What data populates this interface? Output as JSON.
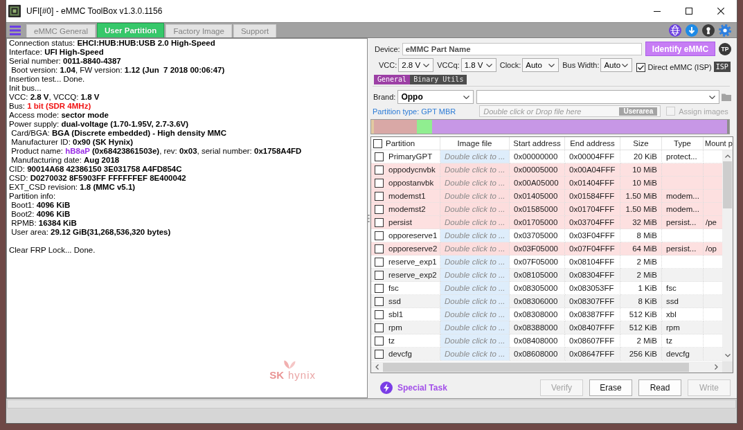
{
  "window": {
    "title": "UFI[#0] - eMMC ToolBox v1.3.0.1156"
  },
  "tabs": [
    {
      "label": "eMMC General",
      "selected": false
    },
    {
      "label": "User Partition",
      "selected": true
    },
    {
      "label": "Factory Image",
      "selected": false
    },
    {
      "label": "Support",
      "selected": false
    }
  ],
  "log": {
    "paragraphs": [
      {
        "lines": [
          {
            "parts": [
              {
                "kind": "label",
                "text": "Connection status: "
              },
              {
                "kind": "value",
                "text": "EHCI:HUB:HUB:USB 2.0 High-Speed"
              }
            ]
          },
          {
            "parts": [
              {
                "kind": "label",
                "text": "Interface: "
              },
              {
                "kind": "value",
                "text": "UFI High-Speed"
              }
            ]
          },
          {
            "parts": [
              {
                "kind": "label",
                "text": "Serial number: "
              },
              {
                "kind": "value",
                "text": "0011-8840-4387"
              }
            ]
          },
          {
            "parts": [
              {
                "kind": "label",
                "text": " Boot version: "
              },
              {
                "kind": "value",
                "text": "1.04"
              },
              {
                "kind": "label",
                "text": ", FW version: "
              },
              {
                "kind": "value",
                "text": "1.12 (Jun  7 2018 00:06:47)"
              }
            ]
          },
          {
            "parts": [
              {
                "kind": "label",
                "text": "Insertion test... Done."
              }
            ]
          },
          {
            "parts": [
              {
                "kind": "label",
                "text": "Init bus..."
              }
            ]
          },
          {
            "parts": [
              {
                "kind": "label",
                "text": "VCC: "
              },
              {
                "kind": "value",
                "text": "2.8 V"
              },
              {
                "kind": "label",
                "text": ", VCCQ: "
              },
              {
                "kind": "value",
                "text": "1.8 V"
              }
            ]
          },
          {
            "parts": [
              {
                "kind": "label",
                "text": "Bus: "
              },
              {
                "kind": "alert",
                "text": "1 bit (SDR 4MHz)"
              }
            ]
          },
          {
            "parts": [
              {
                "kind": "label",
                "text": "Access mode: "
              },
              {
                "kind": "value",
                "text": "sector mode"
              }
            ]
          },
          {
            "parts": [
              {
                "kind": "label",
                "text": "Power supply: "
              },
              {
                "kind": "value",
                "text": "dual-voltage (1.70-1.95V, 2.7-3.6V)"
              }
            ]
          },
          {
            "parts": [
              {
                "kind": "label",
                "text": " Card/BGA: "
              },
              {
                "kind": "value",
                "text": "BGA (Discrete embedded) - High density MMC"
              }
            ]
          },
          {
            "parts": [
              {
                "kind": "label",
                "text": " Manufacturer ID: "
              },
              {
                "kind": "value",
                "text": "0x90 (SK Hynix)"
              }
            ]
          },
          {
            "parts": [
              {
                "kind": "label",
                "text": " Product name: "
              },
              {
                "kind": "accent",
                "text": "hB8aP"
              },
              {
                "kind": "value",
                "text": " (0x68423861503e)"
              },
              {
                "kind": "label",
                "text": ", rev: "
              },
              {
                "kind": "value",
                "text": "0x03"
              },
              {
                "kind": "label",
                "text": ", serial number: "
              },
              {
                "kind": "value",
                "text": "0x1758A4FD"
              }
            ]
          },
          {
            "parts": [
              {
                "kind": "label",
                "text": " Manufacturing date: "
              },
              {
                "kind": "value",
                "text": "Aug 2018"
              }
            ]
          },
          {
            "parts": [
              {
                "kind": "label",
                "text": "CID: "
              },
              {
                "kind": "value",
                "text": "90014A68 42386150 3E031758 A4FD854C"
              }
            ]
          },
          {
            "parts": [
              {
                "kind": "label",
                "text": "CSD: "
              },
              {
                "kind": "value",
                "text": "D0270032 8F5903FF FFFFFFEF 8E400042"
              }
            ]
          },
          {
            "parts": [
              {
                "kind": "label",
                "text": "EXT_CSD revision: "
              },
              {
                "kind": "value",
                "text": "1.8 (MMC v5.1)"
              }
            ]
          },
          {
            "parts": [
              {
                "kind": "label",
                "text": "Partition info:"
              }
            ]
          },
          {
            "parts": [
              {
                "kind": "label",
                "text": " Boot1: "
              },
              {
                "kind": "value",
                "text": "4096 KiB"
              }
            ]
          },
          {
            "parts": [
              {
                "kind": "label",
                "text": " Boot2: "
              },
              {
                "kind": "value",
                "text": "4096 KiB"
              }
            ]
          },
          {
            "parts": [
              {
                "kind": "label",
                "text": " RPMB: "
              },
              {
                "kind": "value",
                "text": "16384 KiB"
              }
            ]
          },
          {
            "parts": [
              {
                "kind": "label",
                "text": " User area: "
              },
              {
                "kind": "value",
                "text": "29.12 GiB(31,268,536,320 bytes)"
              }
            ]
          }
        ]
      },
      {
        "lines": [
          {
            "parts": [
              {
                "kind": "label",
                "text": "Clear FRP Lock... Done."
              }
            ]
          }
        ]
      }
    ],
    "maker_logo": {
      "mark": "SK",
      "name": "hynix"
    }
  },
  "device": {
    "label": "Device:",
    "value": "eMMC Part Name",
    "identify_button": "Identify eMMC",
    "tp_badge": "TP"
  },
  "voltage_settings": [
    {
      "label": "VCC:",
      "value": "2.8 V"
    },
    {
      "label": "VCCq:",
      "value": "1.8 V"
    },
    {
      "label": "Clock:",
      "value": "Auto"
    },
    {
      "label": "Bus Width:",
      "value": "Auto"
    }
  ],
  "direct_emmc": {
    "label": "Direct eMMC (ISP)",
    "checked": true,
    "badge": "ISP"
  },
  "sub_tabs": [
    {
      "label": "General",
      "selected": true
    },
    {
      "label": "Binary Utils",
      "selected": false
    }
  ],
  "brand": {
    "label": "Brand:",
    "value": "Oppo"
  },
  "partition_type": "Partition type: GPT MBR",
  "image_drop": {
    "placeholder": "Double click or Drop file here",
    "badge": "Userarea"
  },
  "assign_images": {
    "label": "Assign images",
    "checked": false,
    "disabled": true
  },
  "table": {
    "all_checked": false,
    "columns": [
      "Partition",
      "Image file",
      "Start address",
      "End address",
      "Size",
      "Type",
      "Mount p"
    ],
    "rows": [
      {
        "checked": false,
        "highlighted": false,
        "partition": "PrimaryGPT",
        "image_file": "Double click to ...",
        "start_address": "0x00000000",
        "end_address": "0x00004FFF",
        "size": "20 KiB",
        "type": "protect..."
      },
      {
        "checked": false,
        "highlighted": true,
        "partition": "oppodycnvbk",
        "image_file": "Double click to ...",
        "start_address": "0x00005000",
        "end_address": "0x00A04FFF",
        "size": "10 MiB"
      },
      {
        "checked": false,
        "highlighted": true,
        "partition": "oppostanvbk",
        "image_file": "Double click to ...",
        "start_address": "0x00A05000",
        "end_address": "0x01404FFF",
        "size": "10 MiB"
      },
      {
        "checked": false,
        "highlighted": true,
        "partition": "modemst1",
        "image_file": "Double click to ...",
        "start_address": "0x01405000",
        "end_address": "0x01584FFF",
        "size": "1.50 MiB",
        "type": "modem..."
      },
      {
        "checked": false,
        "highlighted": true,
        "partition": "modemst2",
        "image_file": "Double click to ...",
        "start_address": "0x01585000",
        "end_address": "0x01704FFF",
        "size": "1.50 MiB",
        "type": "modem..."
      },
      {
        "checked": false,
        "highlighted": true,
        "partition": "persist",
        "image_file": "Double click to ...",
        "start_address": "0x01705000",
        "end_address": "0x03704FFF",
        "size": "32 MiB",
        "type": "persist...",
        "mount": "/pe"
      },
      {
        "checked": false,
        "highlighted": false,
        "partition": "opporeserve1",
        "image_file": "Double click to ...",
        "start_address": "0x03705000",
        "end_address": "0x03F04FFF",
        "size": "8 MiB"
      },
      {
        "checked": false,
        "highlighted": true,
        "partition": "opporeserve2",
        "image_file": "Double click to ...",
        "start_address": "0x03F05000",
        "end_address": "0x07F04FFF",
        "size": "64 MiB",
        "type": "persist...",
        "mount": "/op"
      },
      {
        "checked": false,
        "highlighted": false,
        "partition": "reserve_exp1",
        "image_file": "Double click to ...",
        "start_address": "0x07F05000",
        "end_address": "0x08104FFF",
        "size": "2 MiB"
      },
      {
        "checked": false,
        "highlighted": false,
        "partition": "reserve_exp2",
        "image_file": "Double click to ...",
        "start_address": "0x08105000",
        "end_address": "0x08304FFF",
        "size": "2 MiB"
      },
      {
        "checked": false,
        "highlighted": false,
        "partition": "fsc",
        "image_file": "Double click to ...",
        "start_address": "0x08305000",
        "end_address": "0x083053FF",
        "size": "1 KiB",
        "type": "fsc"
      },
      {
        "checked": false,
        "highlighted": false,
        "partition": "ssd",
        "image_file": "Double click to ...",
        "start_address": "0x08306000",
        "end_address": "0x08307FFF",
        "size": "8 KiB",
        "type": "ssd"
      },
      {
        "checked": false,
        "highlighted": false,
        "partition": "sbl1",
        "image_file": "Double click to ...",
        "start_address": "0x08308000",
        "end_address": "0x08387FFF",
        "size": "512 KiB",
        "type": "xbl"
      },
      {
        "checked": false,
        "highlighted": false,
        "partition": "rpm",
        "image_file": "Double click to ...",
        "start_address": "0x08388000",
        "end_address": "0x08407FFF",
        "size": "512 KiB",
        "type": "rpm"
      },
      {
        "checked": false,
        "highlighted": false,
        "partition": "tz",
        "image_file": "Double click to ...",
        "start_address": "0x08408000",
        "end_address": "0x08607FFF",
        "size": "2 MiB",
        "type": "tz"
      },
      {
        "checked": false,
        "highlighted": false,
        "partition": "devcfg",
        "image_file": "Double click to ...",
        "start_address": "0x08608000",
        "end_address": "0x08647FFF",
        "size": "256 KiB",
        "type": "devcfg"
      }
    ]
  },
  "special_task": "Special Task",
  "buttons": [
    {
      "label": "Verify",
      "disabled": true
    },
    {
      "label": "Erase",
      "disabled": false
    },
    {
      "label": "Read",
      "disabled": false
    },
    {
      "label": "Write",
      "disabled": true
    }
  ]
}
